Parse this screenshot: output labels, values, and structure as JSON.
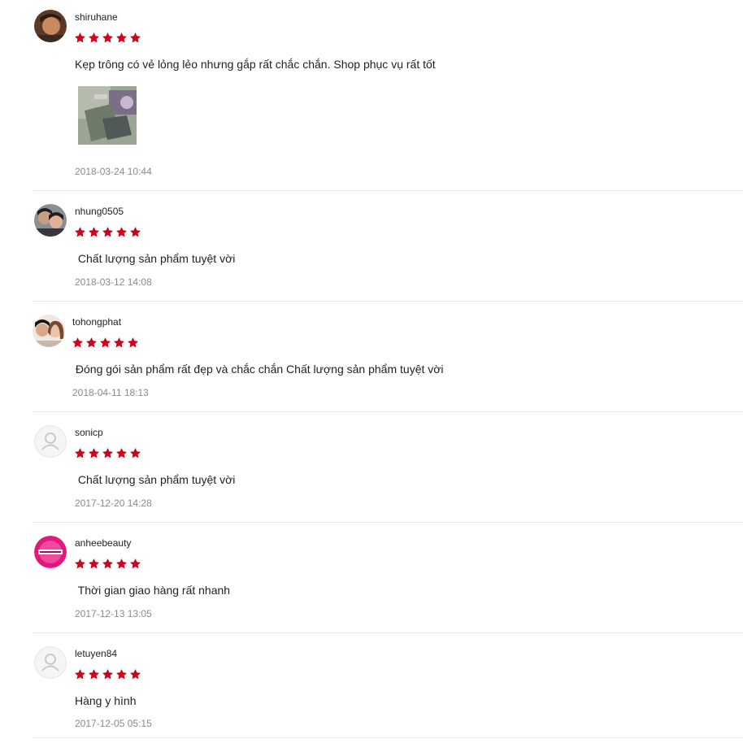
{
  "colors": {
    "star": "#d0011b",
    "divider": "#e8e8e8",
    "timestamp": "#8a8a8a",
    "text": "#222222"
  },
  "reviews": [
    {
      "username": "shiruhane",
      "rating": 5,
      "comment": "Kẹp trông có vẻ lỏng lẻo nhưng gắp rất chắc chắn. Shop phục vụ rất tốt",
      "has_photo": true,
      "timestamp": "2018-03-24 10:44",
      "avatar": "user-photo-avatar"
    },
    {
      "username": "nhung0505",
      "rating": 5,
      "comment": " Chất lượng sản phẩm tuyệt vời",
      "timestamp": "2018-03-12 14:08",
      "avatar": "user-photo-avatar"
    },
    {
      "username": "tohongphat",
      "rating": 5,
      "comment": " Đóng gói sản phẩm rất đẹp và chắc chắn Chất lượng sản phẩm tuyệt vời",
      "timestamp": "2018-04-11 18:13",
      "avatar": "user-photo-avatar"
    },
    {
      "username": "sonicp",
      "rating": 5,
      "comment": " Chất lượng sản phẩm tuyệt vời",
      "timestamp": "2017-12-20 14:28",
      "avatar": "default-user-icon"
    },
    {
      "username": "anheebeauty",
      "rating": 5,
      "comment": " Thời gian giao hàng rất nhanh",
      "timestamp": "2017-12-13 13:05",
      "avatar": "brand-logo-avatar"
    },
    {
      "username": "letuyen84",
      "rating": 5,
      "comment": "Hàng y hình",
      "timestamp": "2017-12-05 05:15",
      "avatar": "default-user-icon"
    }
  ]
}
